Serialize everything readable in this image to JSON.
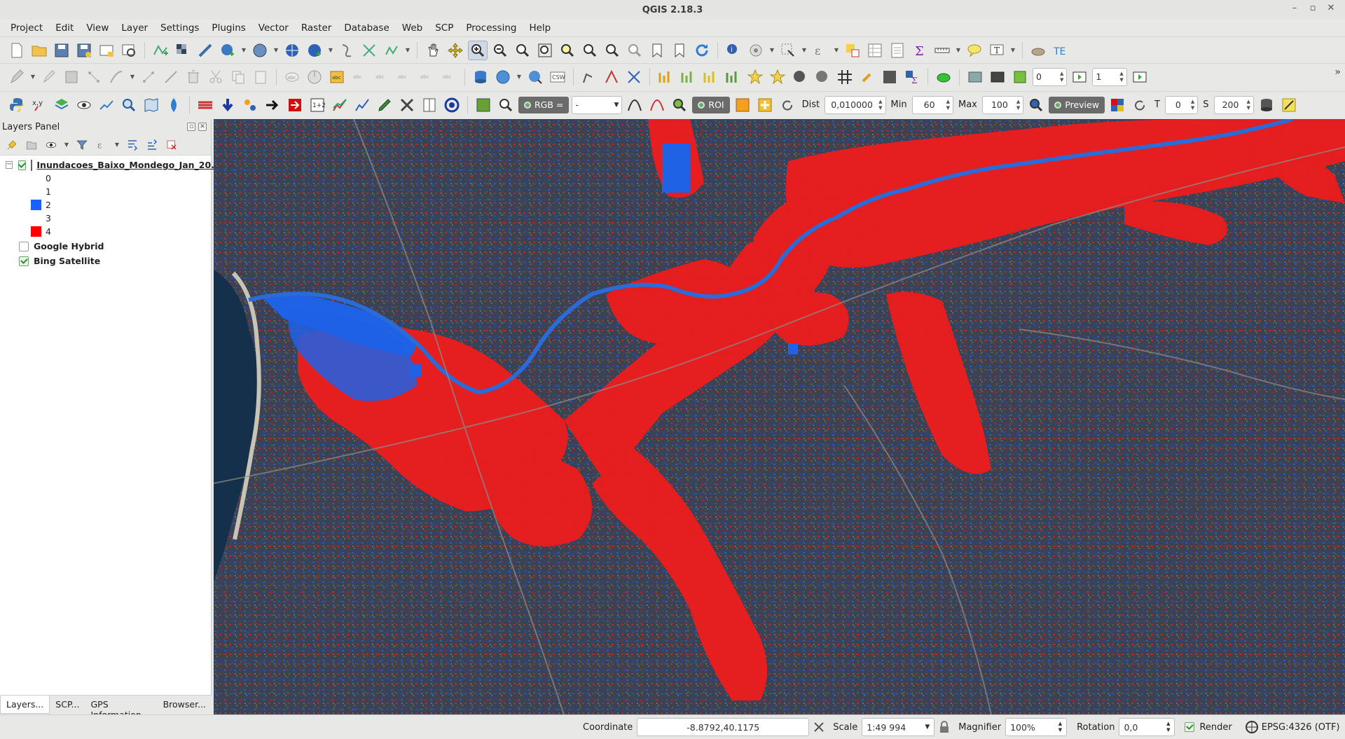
{
  "window": {
    "title": "QGIS 2.18.3"
  },
  "menu": [
    "Project",
    "Edit",
    "View",
    "Layer",
    "Settings",
    "Plugins",
    "Vector",
    "Raster",
    "Database",
    "Web",
    "SCP",
    "Processing",
    "Help"
  ],
  "toolbar3": {
    "rgb_label": "RGB =",
    "rgb_value": "-",
    "roi_label": "ROI",
    "dist_label": "Dist",
    "dist_value": "0,010000",
    "min_label": "Min",
    "min_value": "60",
    "max_label": "Max",
    "max_value": "100",
    "preview_label": "Preview",
    "t_label": "T",
    "t_value": "0",
    "s_label": "S",
    "s_value": "200"
  },
  "toolbar2": {
    "spin1_value": "0",
    "spin2_value": "1"
  },
  "layers_panel": {
    "title": "Layers Panel",
    "layers": [
      {
        "name": "Inundacoes_Baixo_Mondego_Jan_20...",
        "checked": true,
        "classes": [
          {
            "label": "0",
            "color": ""
          },
          {
            "label": "1",
            "color": ""
          },
          {
            "label": "2",
            "color": "#1a5fff"
          },
          {
            "label": "3",
            "color": ""
          },
          {
            "label": "4",
            "color": "#ff0000"
          }
        ]
      },
      {
        "name": "Google Hybrid",
        "checked": false
      },
      {
        "name": "Bing Satellite",
        "checked": true
      }
    ]
  },
  "bottom_tabs": [
    "Layers...",
    "SCP...",
    "GPS Information...",
    "Browser..."
  ],
  "status": {
    "coordinate_label": "Coordinate",
    "coordinate_value": "-8.8792,40.1175",
    "scale_label": "Scale",
    "scale_value": "1:49 994",
    "magnifier_label": "Magnifier",
    "magnifier_value": "100%",
    "rotation_label": "Rotation",
    "rotation_value": "0,0",
    "render_label": "Render",
    "crs_label": "EPSG:4326 (OTF)"
  },
  "colors": {
    "flood_red": "#ee1c1c",
    "water_blue": "#1f62e6",
    "sea": "#14304a"
  }
}
